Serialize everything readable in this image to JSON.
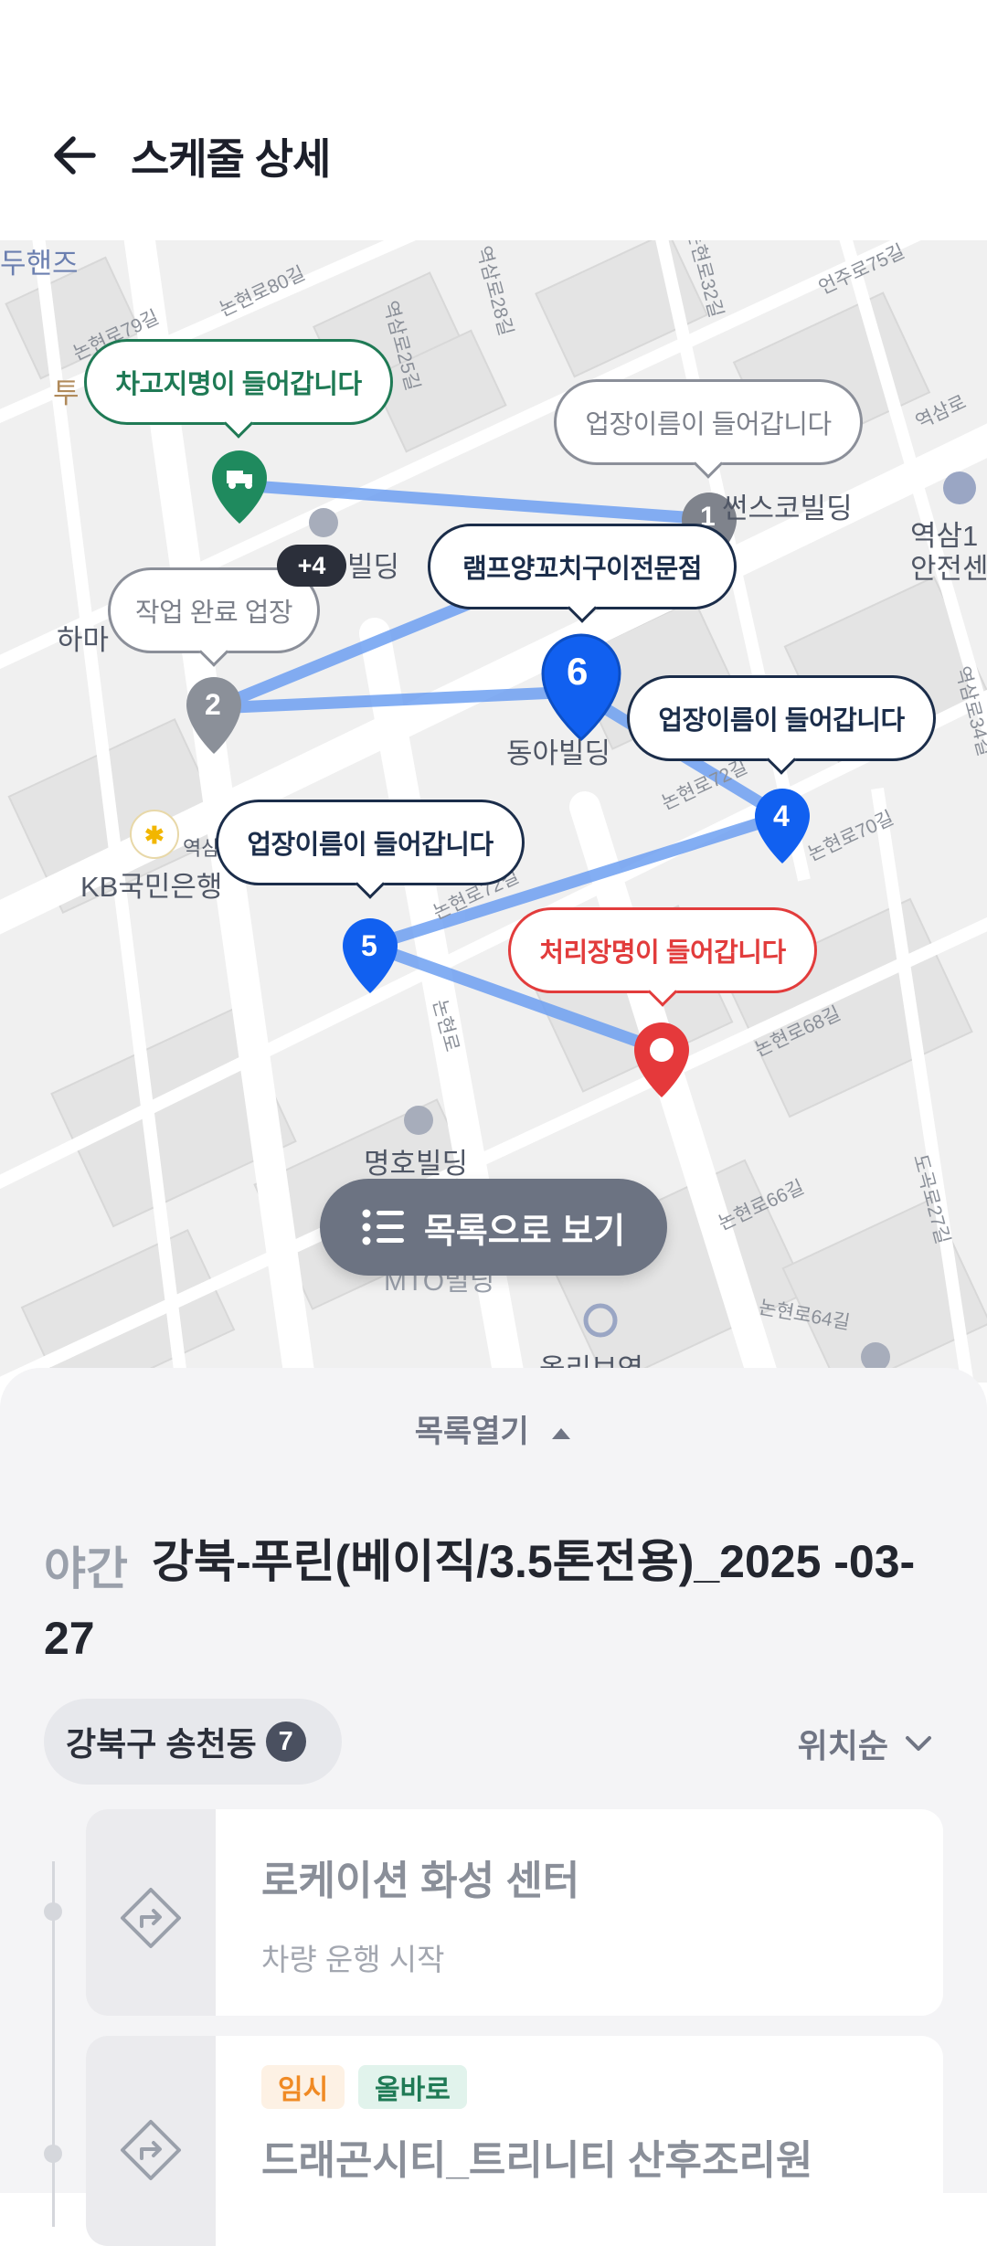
{
  "header": {
    "title": "스케줄 상세"
  },
  "map": {
    "bubbles": {
      "depot": "차고지명이 들어갑니다",
      "stop1": "업장이름이 들어갑니다",
      "stop2": "작업 완료 업장",
      "stop6": "램프양꼬치구이전문점",
      "stop4": "업장이름이 들어갑니다",
      "stop5": "업장이름이 들어갑니다",
      "disposal": "처리장명이 들어갑니다"
    },
    "markers": {
      "m1": "1",
      "m2": "2",
      "m4": "4",
      "m5": "5",
      "m6": "6"
    },
    "cluster_count": "+4",
    "labels": {
      "kb": "KB국민은행",
      "hama": "하마",
      "dong_a": "동아빌딩",
      "myeongho": "명호빌딩",
      "olive": "올리브영",
      "bunsuko": "썬스코빌딩",
      "yeoksam": "역삼1",
      "anjeon": "안전센",
      "du": "두핸즈",
      "bilding": "빌딩",
      "mto": "MTO빌딩",
      "yeok": "역삼",
      "tu": "투"
    },
    "streets": {
      "s1": "논현로80길",
      "s2": "논현로79길",
      "s3": "역삼로25길",
      "s4": "역삼로28길",
      "s5": "논현로32길",
      "s6": "언주로75길",
      "s7": "논현로72길",
      "s8": "논현로70길",
      "s9": "논현로68길",
      "s10": "논현로66길",
      "s11": "논현로64길",
      "s12": "논현로",
      "s13": "역삼로",
      "s14": "도곡로27길",
      "s15": "역삼로34길",
      "s16": "논현로72길"
    },
    "list_button": "목록으로 보기"
  },
  "sheet": {
    "toggle": "목록열기",
    "shift": "야간",
    "title": "강북-푸린(베이직/3.5톤전용)_2025 -03-27",
    "area": "강북구 송천동",
    "area_count": "7",
    "sort": "위치순",
    "cards": [
      {
        "name": "로케이션 화성 센터",
        "sub": "차량 운행 시작"
      },
      {
        "name": "드래곤시티_트리니티 산후조리원",
        "tags": [
          "임시",
          "올바로"
        ]
      }
    ]
  }
}
